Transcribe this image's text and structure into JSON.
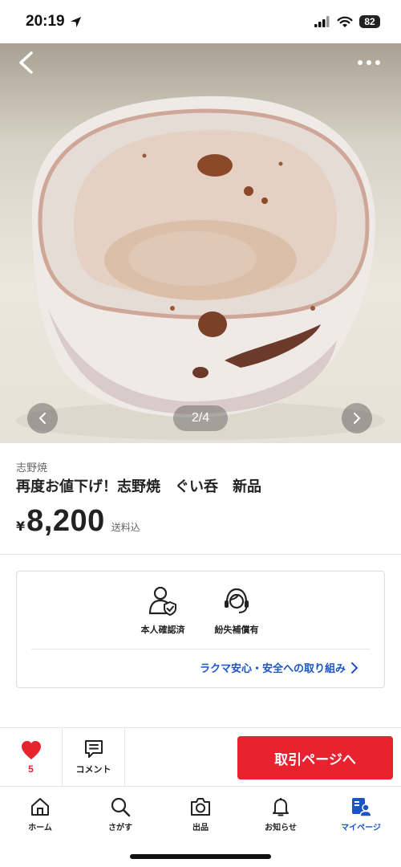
{
  "status_bar": {
    "time": "20:19",
    "battery": "82"
  },
  "product": {
    "photo_indicator": "2/4",
    "brand": "志野焼",
    "title": "再度お値下げ！志野焼　ぐい呑　新品",
    "currency": "¥",
    "price": "8,200",
    "shipping": "送料込"
  },
  "safety": {
    "features": [
      {
        "label": "本人確認済",
        "icon": "verified-person-icon"
      },
      {
        "label": "紛失補償有",
        "icon": "support-headset-icon"
      }
    ],
    "link_label": "ラクマ安心・安全への取り組み"
  },
  "actions": {
    "like_count": "5",
    "comment_label": "コメント",
    "buy_label": "取引ページへ"
  },
  "tab_bar": {
    "items": [
      {
        "label": "ホーム",
        "icon": "home-icon"
      },
      {
        "label": "さがす",
        "icon": "search-icon"
      },
      {
        "label": "出品",
        "icon": "camera-icon"
      },
      {
        "label": "お知らせ",
        "icon": "bell-icon"
      },
      {
        "label": "マイページ",
        "icon": "profile-icon"
      }
    ],
    "active_index": 4
  },
  "colors": {
    "accent_red": "#e8232f",
    "link_blue": "#1a55c5"
  }
}
